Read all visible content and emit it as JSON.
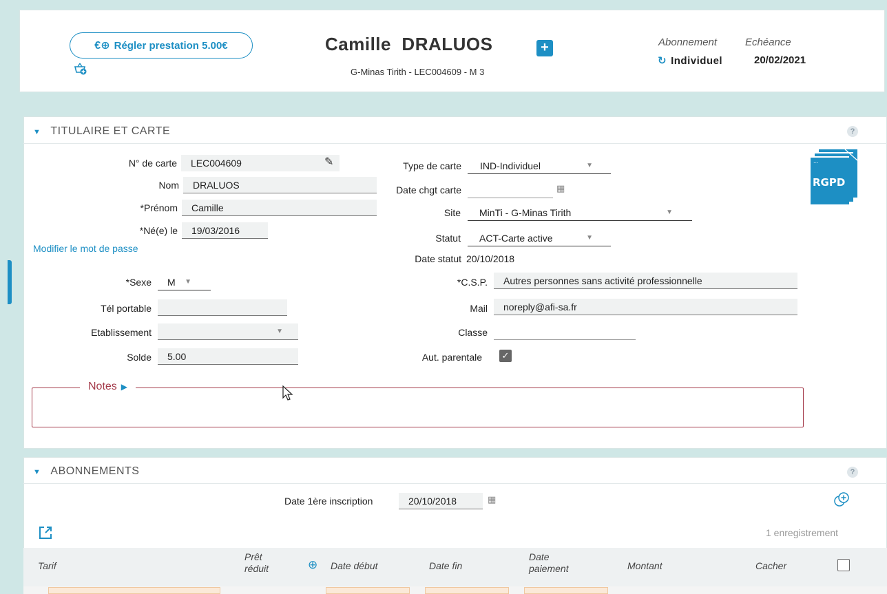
{
  "header": {
    "pay_button_label": "Régler prestation 5.00€",
    "patron_name": "Camille  DRALUOS",
    "patron_subtitle": "G-Minas Tirith - LEC004609 - M 3",
    "subscription_label": "Abonnement",
    "due_label": "Echéance",
    "subscription_value": "Individuel",
    "due_value": "20/02/2021"
  },
  "titulaire": {
    "section_title": "TITULAIRE ET CARTE",
    "help": "?",
    "card_number_label": "N° de carte",
    "card_number": "LEC004609",
    "last_name_label": "Nom",
    "last_name": "DRALUOS",
    "first_name_label": "*Prénom",
    "first_name": "Camille",
    "birth_label": "*Né(e) le",
    "birth_date": "19/03/2016",
    "change_password_link": "Modifier le mot de passe",
    "sex_label": "*Sexe",
    "sex_value": "M",
    "mobile_label": "Tél portable",
    "mobile_value": "",
    "school_label": "Etablissement",
    "school_value": "",
    "balance_label": "Solde",
    "balance_value": "5.00",
    "card_type_label": "Type de carte",
    "card_type_value": "IND-Individuel",
    "card_change_date_label": "Date chgt carte",
    "card_change_date_value": "",
    "site_label": "Site",
    "site_value": "MinTi - G-Minas Tirith",
    "status_label": "Statut",
    "status_value": "ACT-Carte active",
    "status_date_label": "Date statut",
    "status_date_value": "20/10/2018",
    "csp_label": "*C.S.P.",
    "csp_value": "Autres personnes sans activité professionnelle",
    "mail_label": "Mail",
    "mail_value": "noreply@afi-sa.fr",
    "class_label": "Classe",
    "class_value": "",
    "parental_label": "Aut. parentale",
    "parental_checked": true,
    "notes_label": "Notes",
    "rgpd_label": "RGPD"
  },
  "abonnements": {
    "section_title": "ABONNEMENTS",
    "help": "?",
    "first_registration_label": "Date 1ère inscription",
    "first_registration_value": "20/10/2018",
    "record_count": "1 enregistrement",
    "columns": [
      "Tarif",
      "Prêt réduit",
      "Date début",
      "Date fin",
      "Date paiement",
      "Montant",
      "Cacher"
    ]
  },
  "colors": {
    "accent": "#1d8fc4",
    "notes_border": "#a43a4a",
    "background": "#cfe7e6"
  }
}
